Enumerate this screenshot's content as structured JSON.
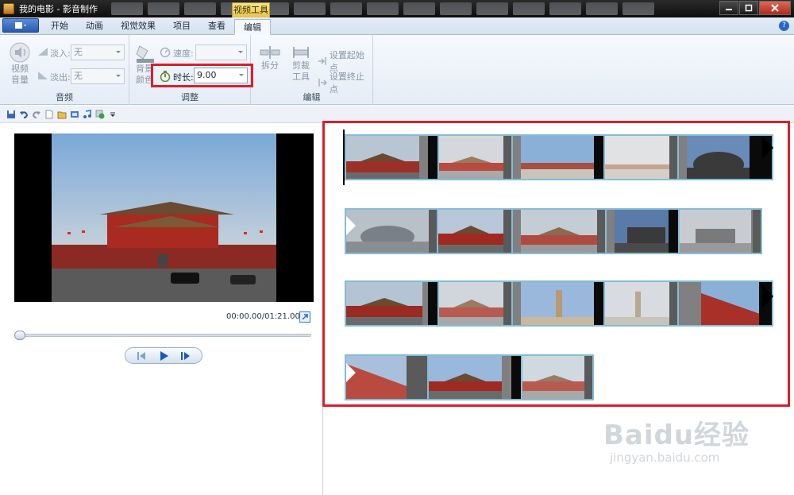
{
  "window": {
    "title": "我的电影 - 影音制作",
    "contextual_tab": "视频工具",
    "controls": [
      "minimize",
      "maximize",
      "close"
    ]
  },
  "tabs": [
    {
      "label": "开始",
      "active": false
    },
    {
      "label": "动画",
      "active": false
    },
    {
      "label": "视觉效果",
      "active": false
    },
    {
      "label": "项目",
      "active": false
    },
    {
      "label": "查看",
      "active": false
    },
    {
      "label": "编辑",
      "active": true
    }
  ],
  "ribbon": {
    "audio_group": {
      "label": "音频",
      "video_volume": "视频\n音量",
      "fade_in_label": "淡入:",
      "fade_in_value": "无",
      "fade_out_label": "淡出:",
      "fade_out_value": "无"
    },
    "adjust_group": {
      "label": "调整",
      "bg_color": "背景\n颜色",
      "speed_label": "速度:",
      "speed_value": "",
      "duration_label": "时长:",
      "duration_value": "9.00"
    },
    "edit_group": {
      "label": "编辑",
      "split": "拆分",
      "trim_tool": "剪裁\n工具",
      "set_start": "设置起始点",
      "set_end": "设置终止点"
    }
  },
  "preview": {
    "time_display": "00:00.00/01:21.00",
    "seek_progress": 0
  },
  "storyboard": {
    "rows": [
      {
        "clips": 5,
        "transition_end": true,
        "transition_start": false
      },
      {
        "clips": 5,
        "transition_end": false,
        "transition_start": true
      },
      {
        "clips": 5,
        "transition_end": true,
        "transition_start": false
      },
      {
        "clips": 3,
        "transition_end": false,
        "transition_start": true
      }
    ],
    "total_clips": 18
  },
  "watermark": {
    "logo": "Baidu经验",
    "url": "jingyan.baidu.com"
  },
  "colors": {
    "highlight": "#d8202a",
    "clip_border": "#84bcd6",
    "ribbon_bg": "#e4ecf6"
  }
}
